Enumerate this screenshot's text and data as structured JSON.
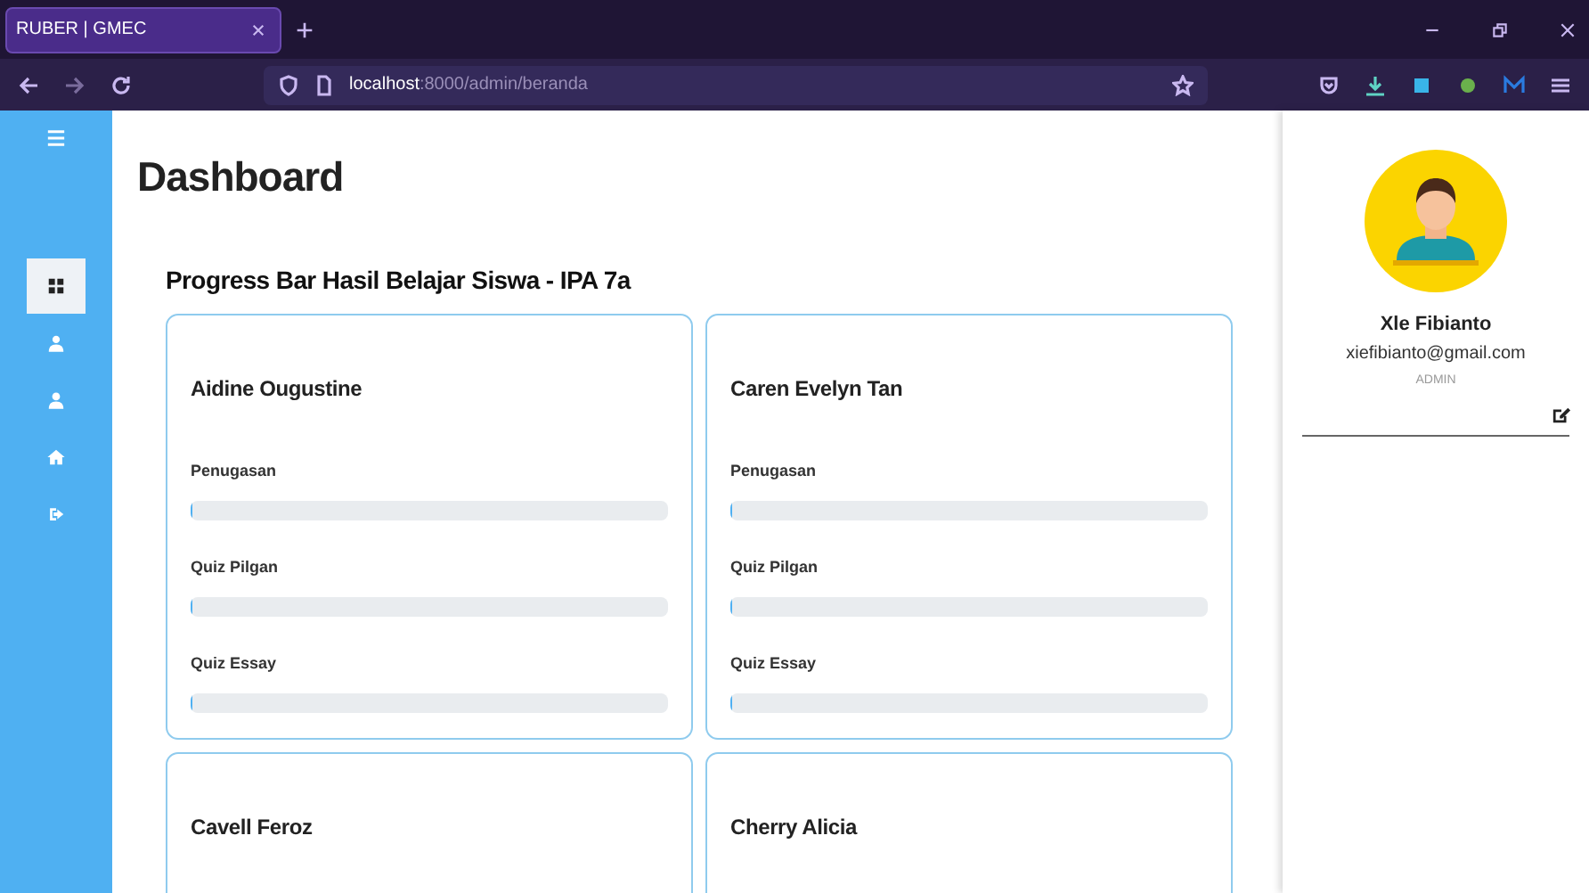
{
  "browser": {
    "tab_title": "RUBER | GMEC",
    "url": "**localhost**:8000/admin/beranda"
  },
  "sidebar": {
    "items": [
      {
        "kind": "dashboard",
        "selected": true
      },
      {
        "kind": "teacher",
        "selected": false
      },
      {
        "kind": "user",
        "selected": false
      },
      {
        "kind": "home",
        "selected": false
      },
      {
        "kind": "logout",
        "selected": false
      }
    ]
  },
  "page_title": "Dashboard",
  "section_title": "Progress Bar Hasil Belajar Siswa - IPA 7a",
  "students": [
    {
      "name": "Aidine Ougustine",
      "bars": [
        {
          "label": "Penugasan",
          "level": 0
        },
        {
          "label": "Quiz Pilgan",
          "level": 0
        },
        {
          "label": "Quiz Essay",
          "level": 0
        }
      ]
    },
    {
      "name": "Caren Evelyn Tan",
      "bars": [
        {
          "label": "Penugasan",
          "level": 0
        },
        {
          "label": "Quiz Pilgan",
          "level": 0
        },
        {
          "label": "Quiz Essay",
          "level": 0
        }
      ]
    },
    {
      "name": "Cavell Feroz"
    },
    {
      "name": "Cherry Alicia"
    }
  ],
  "profile": {
    "name": "Xle Fibianto",
    "email": "xiefibianto@gmail.com",
    "role": "ADMIN"
  }
}
